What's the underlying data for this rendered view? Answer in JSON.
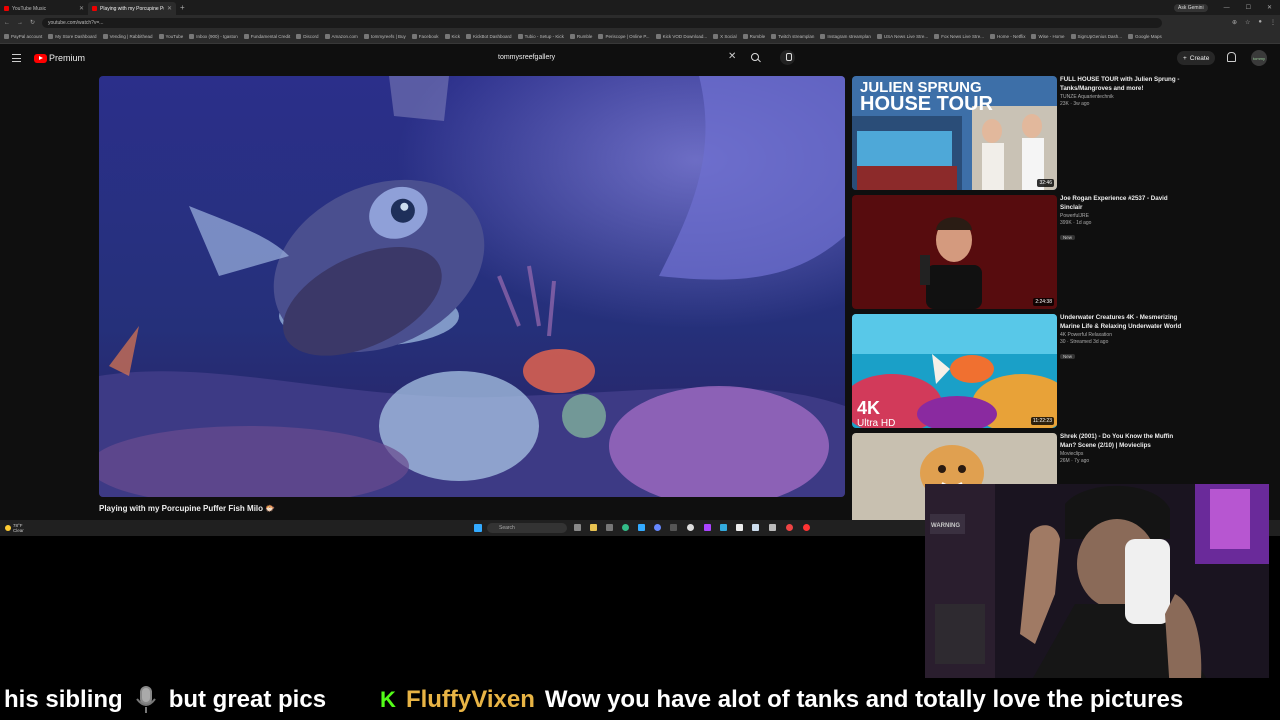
{
  "browser": {
    "tabs": [
      {
        "label": "YouTube Music",
        "active": false
      },
      {
        "label": "Playing with my Porcupine Puf",
        "active": true
      }
    ],
    "ask_gemini": "Ask Gemini",
    "url": "youtube.com/watch?v=...",
    "bookmarks": [
      "PayPal account",
      "My Store Dashboard",
      "Vending | Rabbithead",
      "YouTube",
      "Inbox (900) - tgaston",
      "Fundamental Credit",
      "Discord",
      "Amazon.com",
      "tommyreefs | Buy",
      "Facebook",
      "Kick",
      "KickBot Dashboard",
      "Tubio - Setup - Kick",
      "Rumble",
      "Periscope | Online P...",
      "Kick VOD Download...",
      "X Social",
      "Rumble",
      "Twitch streamplan",
      "Instagram streamplan",
      "USA News Live Stre...",
      "Fox News Live Stre...",
      "Home - Netflix",
      "Wise - Home",
      "SignUpGenius Dash...",
      "Google Maps"
    ]
  },
  "youtube": {
    "logo_text": "Premium",
    "search_query": "tommysreefgallery",
    "create_label": "Create",
    "avatar_text": "tommy",
    "video_title": "Playing with my Porcupine Puffer Fish Milo 🐡",
    "recommendations": [
      {
        "title": "FULL HOUSE TOUR with Julien Sprung - Tanks/Mangroves and more!",
        "channel": "TUNZE Aquarientechnik",
        "meta": "23K · 3w ago",
        "duration": "32:46",
        "badge": "",
        "overlay_line1": "JULIEN SPRUNG",
        "overlay_line2": "HOUSE TOUR"
      },
      {
        "title": "Joe Rogan Experience #2537 - David Sinclair",
        "channel": "PowerfulJRE",
        "meta": "399K · 1d ago",
        "duration": "2:24:38",
        "badge": "New",
        "overlay_line1": "",
        "overlay_line2": ""
      },
      {
        "title": "Underwater Creatures 4K - Mesmerizing Marine Life & Relaxing Underwater World",
        "channel": "4K Powerful Relaxation",
        "meta": "30 · Streamed 3d ago",
        "duration": "11:22:23",
        "badge": "New",
        "overlay_line1": "4K",
        "overlay_line2": "Ultra HD"
      },
      {
        "title": "Shrek (2001) - Do You Know the Muffin Man? Scene (2/10) | Movieclips",
        "channel": "Movieclips",
        "meta": "26M · 7y ago",
        "duration": "",
        "badge": "",
        "overlay_line1": "",
        "overlay_line2": ""
      }
    ]
  },
  "taskbar": {
    "weather_temp": "78°F",
    "weather_desc": "Clear",
    "search_placeholder": "Search"
  },
  "webcam": {
    "sign_text": "WARNING"
  },
  "chat": {
    "prev_text": "his sibling",
    "prev_text2": "but great pics",
    "badge": "K",
    "username": "FluffyVixen",
    "message": "Wow you have alot of tanks and totally love the pictures"
  },
  "colors": {
    "kick_green": "#53fc18",
    "username_gold": "#e8b445",
    "yt_red": "#ff0000"
  }
}
